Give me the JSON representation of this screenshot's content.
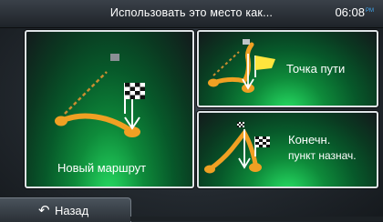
{
  "header": {
    "title": "Использовать это место как...",
    "time": "06:08",
    "ampm": "PM"
  },
  "options": {
    "new_route": {
      "label": "Новый маршрут",
      "icon": "finish-flag-icon"
    },
    "waypoint": {
      "label": "Точка пути",
      "icon": "waypoint-flag-icon"
    },
    "destination": {
      "label_line1": "Конечн.",
      "label_line2": "пункт назнач.",
      "icon": "destination-flag-icon"
    }
  },
  "footer": {
    "back_label": "Назад",
    "back_icon": "back-arrow-icon"
  },
  "colors": {
    "route": "#f0a023",
    "tile_green": "#0e8a3a",
    "accent_blue": "#3fa9f5"
  }
}
